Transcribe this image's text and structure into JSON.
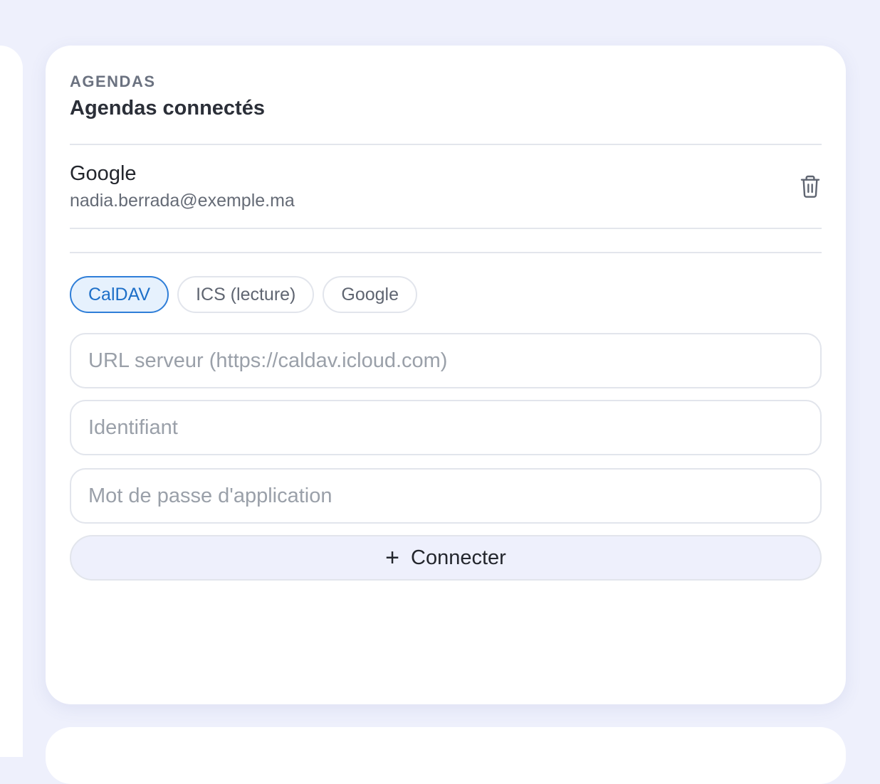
{
  "section": {
    "eyebrow": "AGENDAS",
    "title": "Agendas connectés"
  },
  "connected_accounts": [
    {
      "provider": "Google",
      "email": "nadia.berrada@exemple.ma",
      "action_icon": "trash-icon"
    }
  ],
  "add_form": {
    "tabs": [
      {
        "label": "CalDAV",
        "active": true
      },
      {
        "label": "ICS (lecture)",
        "active": false
      },
      {
        "label": "Google",
        "active": false
      }
    ],
    "fields": {
      "server_url": {
        "placeholder": "URL serveur (https://caldav.icloud.com)",
        "value": ""
      },
      "username": {
        "placeholder": "Identifiant",
        "value": ""
      },
      "app_password": {
        "placeholder": "Mot de passe d'application",
        "value": ""
      }
    },
    "connect_button": {
      "icon": "plus-icon",
      "label": "Connecter"
    }
  },
  "colors": {
    "page_background": "#eef0fc",
    "card_background": "#ffffff",
    "accent": "#2f7ed8",
    "accent_background": "#e6f1fd"
  }
}
